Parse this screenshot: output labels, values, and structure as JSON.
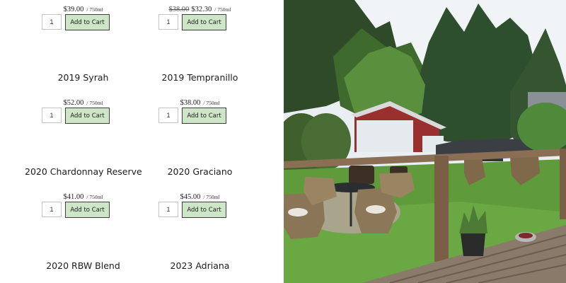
{
  "products": [
    {
      "name": "",
      "price_old": "",
      "price": "$39.00",
      "unit": "/ 750ml",
      "qty": "1",
      "button": "Add to Cart"
    },
    {
      "name": "",
      "price_old": "$38.00",
      "price": "$32.30",
      "unit": "/ 750ml",
      "qty": "1",
      "button": "Add to Cart"
    },
    {
      "name": "2019 Syrah",
      "price_old": "",
      "price": "$52.00",
      "unit": "/ 750ml",
      "qty": "1",
      "button": "Add to Cart"
    },
    {
      "name": "2019 Tempranillo",
      "price_old": "",
      "price": "$38.00",
      "unit": "/ 750ml",
      "qty": "1",
      "button": "Add to Cart"
    },
    {
      "name": "2020 Chardonnay Reserve",
      "price_old": "",
      "price": "$41.00",
      "unit": "/ 750ml",
      "qty": "1",
      "button": "Add to Cart"
    },
    {
      "name": "2020 Graciano",
      "price_old": "",
      "price": "$45.00",
      "unit": "/ 750ml",
      "qty": "1",
      "button": "Add to Cart"
    },
    {
      "name": "2020 RBW Blend",
      "price_old": "",
      "price": "",
      "unit": "",
      "qty": "",
      "button": ""
    },
    {
      "name": "2023 Adriana",
      "price_old": "",
      "price": "",
      "unit": "",
      "qty": "",
      "button": ""
    }
  ],
  "colors": {
    "button_bg": "#cde6c8",
    "button_border": "#3e3e3e"
  },
  "photo": {
    "subject": "patio-garden-photo"
  }
}
